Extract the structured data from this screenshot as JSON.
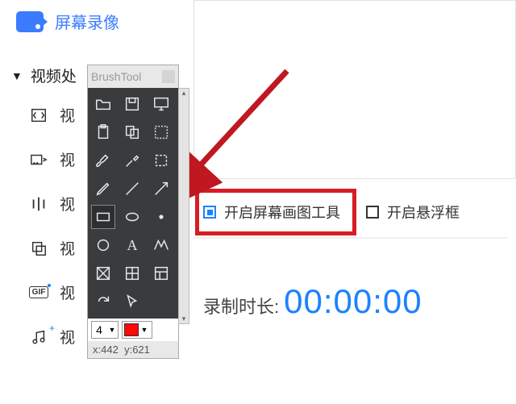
{
  "brand": {
    "title": "屏幕录像"
  },
  "sidebar": {
    "tree_header": "视频处",
    "items": [
      {
        "label": "视",
        "icon": "resize-icon"
      },
      {
        "label": "视",
        "icon": "swap-icon"
      },
      {
        "label": "视",
        "icon": "equalizer-icon"
      },
      {
        "label": "视",
        "icon": "copy-icon"
      },
      {
        "label": "视",
        "icon": "gif-icon"
      },
      {
        "label": "视",
        "icon": "music-icon"
      }
    ]
  },
  "brush": {
    "title": "BrushTool",
    "tools": [
      "open-folder",
      "save",
      "monitor",
      "clipboard",
      "copy",
      "grid-dashed",
      "brush",
      "eyedropper",
      "dashed-box",
      "pencil",
      "line",
      "arrow-line",
      "rectangle",
      "ellipse",
      "dot",
      "circle",
      "letter-a",
      "zigzag",
      "transparent",
      "grid",
      "layout",
      "redo",
      "cursor",
      "blank"
    ],
    "selected": "rectangle",
    "stroke_width": "4",
    "color": "#ff0808",
    "status_x_label": "x:",
    "status_x": "442",
    "status_y_label": "y:",
    "status_y": "621"
  },
  "checks": {
    "draw_tool": {
      "label": "开启屏幕画图工具",
      "checked": true
    },
    "float_box": {
      "label": "开启悬浮框",
      "checked": false
    }
  },
  "timer": {
    "label": "录制时长:",
    "value": "00:00:00"
  }
}
